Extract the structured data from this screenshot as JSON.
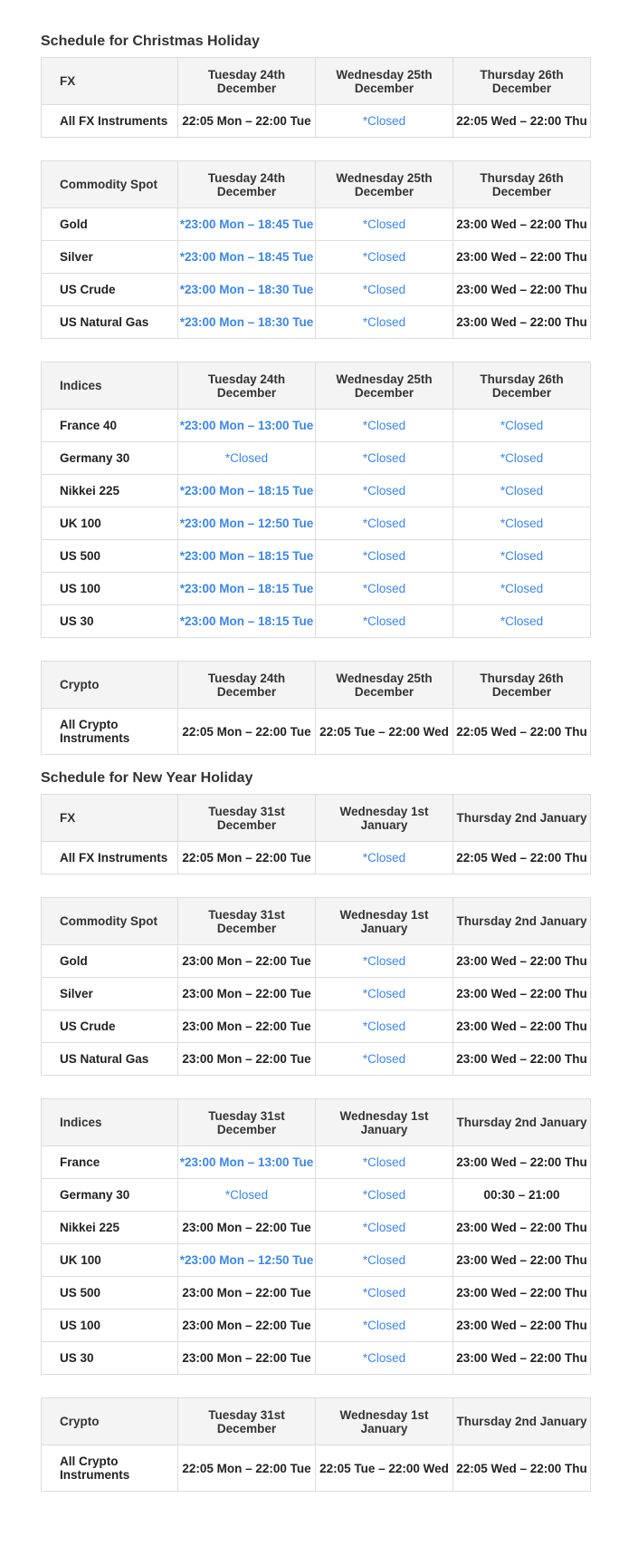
{
  "christmas": {
    "title": "Schedule for Christmas Holiday",
    "day_headers": [
      "Tuesday 24th December",
      "Wednesday 25th December",
      "Thursday 26th December"
    ],
    "tables": [
      {
        "category": "FX",
        "rows": [
          {
            "label": "All FX Instruments",
            "cells": [
              "22:05 Mon – 22:00 Tue",
              "*Closed",
              "22:05 Wed – 22:00 Thu"
            ]
          }
        ]
      },
      {
        "category": "Commodity Spot",
        "rows": [
          {
            "label": "Gold",
            "cells": [
              "*23:00 Mon – 18:45 Tue",
              "*Closed",
              "23:00 Wed – 22:00 Thu"
            ]
          },
          {
            "label": "Silver",
            "cells": [
              "*23:00 Mon – 18:45 Tue",
              "*Closed",
              "23:00 Wed – 22:00 Thu"
            ]
          },
          {
            "label": "US Crude",
            "cells": [
              "*23:00 Mon – 18:30 Tue",
              "*Closed",
              "23:00 Wed – 22:00 Thu"
            ]
          },
          {
            "label": "US Natural Gas",
            "cells": [
              "*23:00 Mon – 18:30 Tue",
              "*Closed",
              "23:00 Wed – 22:00 Thu"
            ]
          }
        ]
      },
      {
        "category": "Indices",
        "rows": [
          {
            "label": "France 40",
            "cells": [
              "*23:00 Mon – 13:00 Tue",
              "*Closed",
              "*Closed"
            ]
          },
          {
            "label": "Germany 30",
            "cells": [
              "*Closed",
              "*Closed",
              "*Closed"
            ]
          },
          {
            "label": "Nikkei 225",
            "cells": [
              "*23:00 Mon – 18:15 Tue",
              "*Closed",
              "*Closed"
            ]
          },
          {
            "label": "UK 100",
            "cells": [
              "*23:00 Mon – 12:50 Tue",
              "*Closed",
              "*Closed"
            ]
          },
          {
            "label": "US 500",
            "cells": [
              "*23:00 Mon – 18:15 Tue",
              "*Closed",
              "*Closed"
            ]
          },
          {
            "label": "US 100",
            "cells": [
              "*23:00 Mon – 18:15 Tue",
              "*Closed",
              "*Closed"
            ]
          },
          {
            "label": "US 30",
            "cells": [
              "*23:00 Mon – 18:15 Tue",
              "*Closed",
              "*Closed"
            ]
          }
        ]
      },
      {
        "category": "Crypto",
        "rows": [
          {
            "label": "All Crypto Instruments",
            "cells": [
              "22:05 Mon – 22:00 Tue",
              "22:05 Tue – 22:00 Wed",
              "22:05 Wed – 22:00 Thu"
            ]
          }
        ]
      }
    ]
  },
  "new_year": {
    "title": "Schedule for New Year Holiday",
    "day_headers": [
      "Tuesday 31st December",
      "Wednesday 1st January",
      "Thursday 2nd January"
    ],
    "tables": [
      {
        "category": "FX",
        "rows": [
          {
            "label": "All FX Instruments",
            "cells": [
              "22:05 Mon – 22:00 Tue",
              "*Closed",
              "22:05 Wed – 22:00 Thu"
            ]
          }
        ]
      },
      {
        "category": "Commodity Spot",
        "rows": [
          {
            "label": "Gold",
            "cells": [
              "23:00 Mon – 22:00 Tue",
              "*Closed",
              "23:00 Wed – 22:00 Thu"
            ]
          },
          {
            "label": "Silver",
            "cells": [
              "23:00 Mon – 22:00 Tue",
              "*Closed",
              "23:00 Wed – 22:00 Thu"
            ]
          },
          {
            "label": "US Crude",
            "cells": [
              "23:00 Mon – 22:00 Tue",
              "*Closed",
              "23:00 Wed – 22:00 Thu"
            ]
          },
          {
            "label": "US Natural Gas",
            "cells": [
              "23:00 Mon – 22:00 Tue",
              "*Closed",
              "23:00 Wed – 22:00 Thu"
            ]
          }
        ]
      },
      {
        "category": "Indices",
        "rows": [
          {
            "label": "France",
            "cells": [
              "*23:00 Mon – 13:00 Tue",
              "*Closed",
              "23:00 Wed – 22:00 Thu"
            ]
          },
          {
            "label": "Germany 30",
            "cells": [
              "*Closed",
              "*Closed",
              "00:30 – 21:00"
            ]
          },
          {
            "label": "Nikkei 225",
            "cells": [
              "23:00 Mon – 22:00 Tue",
              "*Closed",
              "23:00 Wed – 22:00 Thu"
            ]
          },
          {
            "label": "UK 100",
            "cells": [
              "*23:00 Mon – 12:50 Tue",
              "*Closed",
              "23:00 Wed – 22:00 Thu"
            ]
          },
          {
            "label": "US 500",
            "cells": [
              "23:00 Mon – 22:00 Tue",
              "*Closed",
              "23:00 Wed – 22:00 Thu"
            ]
          },
          {
            "label": "US 100",
            "cells": [
              "23:00 Mon – 22:00 Tue",
              "*Closed",
              "23:00 Wed – 22:00 Thu"
            ]
          },
          {
            "label": "US 30",
            "cells": [
              "23:00 Mon – 22:00 Tue",
              "*Closed",
              "23:00 Wed – 22:00 Thu"
            ]
          }
        ]
      },
      {
        "category": "Crypto",
        "rows": [
          {
            "label": "All Crypto Instruments",
            "cells": [
              "22:05 Mon – 22:00 Tue",
              "22:05 Tue – 22:00 Wed",
              "22:05 Wed – 22:00 Thu"
            ]
          }
        ]
      }
    ]
  },
  "colors": {
    "highlight_text": "#3b86e8",
    "header_background": "#f4f4f4",
    "border": "#dcdcdc"
  }
}
